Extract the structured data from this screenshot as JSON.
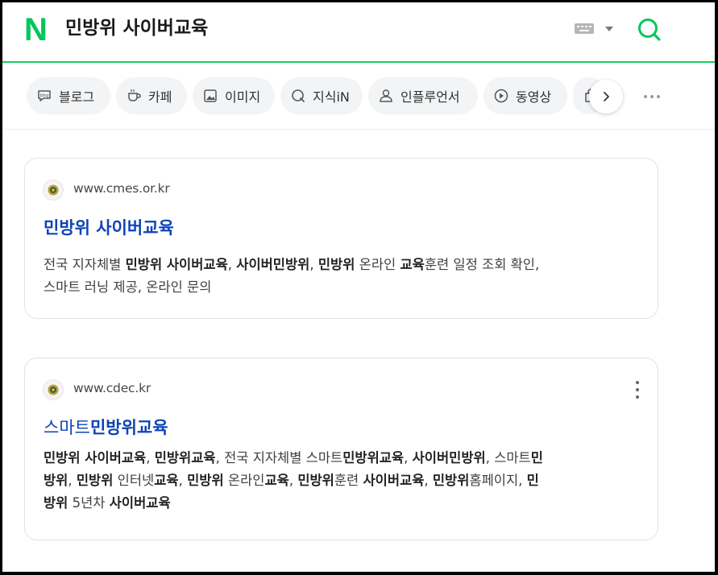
{
  "header": {
    "logo": "N",
    "query": "민방위 사이버교육"
  },
  "tabs": [
    {
      "label": "블로그",
      "icon": "blog-icon"
    },
    {
      "label": "카페",
      "icon": "cafe-cup-icon"
    },
    {
      "label": "이미지",
      "icon": "image-icon"
    },
    {
      "label": "지식iN",
      "icon": "kin-q-icon"
    },
    {
      "label": "인플루언서",
      "icon": "person-icon"
    },
    {
      "label": "동영상",
      "icon": "play-icon"
    },
    {
      "label": "",
      "icon": "shopping-bag-icon"
    }
  ],
  "colors": {
    "brand_green": "#03c75a",
    "link_blue": "#0c43b7"
  },
  "results": [
    {
      "url": "www.cmes.or.kr",
      "title": [
        "민방위 사이버교육"
      ],
      "desc_lines": [
        [
          [
            "전국 지자체별 ",
            false
          ],
          [
            "민방위 사이버교육",
            true
          ],
          [
            ", ",
            false
          ],
          [
            "사이버민방위",
            true
          ],
          [
            ", ",
            false
          ],
          [
            "민방위",
            true
          ],
          [
            " 온라인 ",
            false
          ],
          [
            "교육",
            true
          ],
          [
            "훈련 일정 조회 확인,",
            false
          ]
        ],
        [
          [
            "스마트 러닝 제공, 온라인 문의",
            false
          ]
        ]
      ]
    },
    {
      "url": "www.cdec.kr",
      "title_plain": "스마트",
      "title_bold": "민방위교육",
      "desc_lines": [
        [
          [
            "민방위 사이버교육",
            true
          ],
          [
            ", ",
            false
          ],
          [
            "민방위교육",
            true
          ],
          [
            ", 전국 지자체별 스마트",
            false
          ],
          [
            "민방위교육",
            true
          ],
          [
            ", ",
            false
          ],
          [
            "사이버민방위",
            true
          ],
          [
            ", 스마트",
            false
          ],
          [
            "민",
            true
          ]
        ],
        [
          [
            "방위",
            true
          ],
          [
            ", ",
            false
          ],
          [
            "민방위",
            true
          ],
          [
            " 인터넷",
            false
          ],
          [
            "교육",
            true
          ],
          [
            ", ",
            false
          ],
          [
            "민방위",
            true
          ],
          [
            " 온라인",
            false
          ],
          [
            "교육",
            true
          ],
          [
            ", ",
            false
          ],
          [
            "민방위",
            true
          ],
          [
            "훈련 ",
            false
          ],
          [
            "사이버교육",
            true
          ],
          [
            ", ",
            false
          ],
          [
            "민방위",
            true
          ],
          [
            "홈페이지, ",
            false
          ],
          [
            "민",
            true
          ]
        ],
        [
          [
            "방위",
            true
          ],
          [
            " 5년차 ",
            false
          ],
          [
            "사이버교육",
            true
          ]
        ]
      ]
    }
  ]
}
